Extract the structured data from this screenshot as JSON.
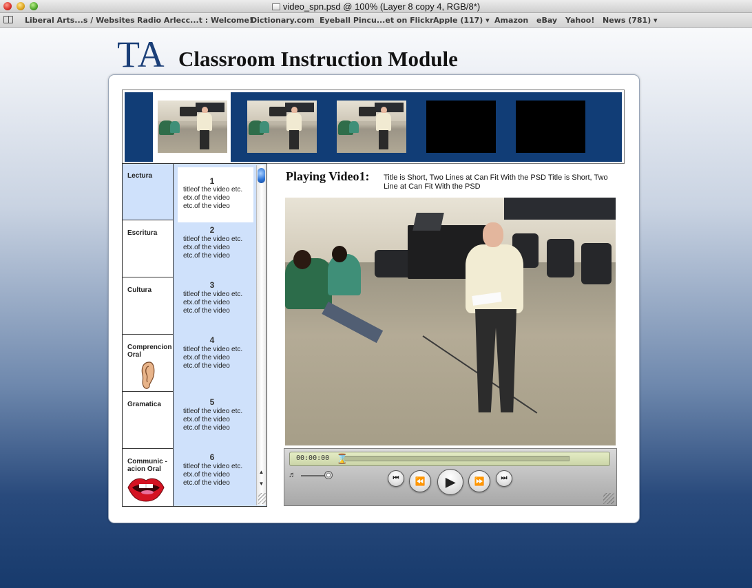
{
  "window": {
    "title": "video_spn.psd @ 100% (Layer 8 copy 4, RGB/8*)"
  },
  "bookmarks": [
    "Liberal Arts...s / Websites",
    "Radio Arlecc...t : Welcome!",
    "Dictionary.com",
    "Eyeball Pincu...et on Flickr",
    "Apple (117) ▾",
    "Amazon",
    "eBay",
    "Yahoo!",
    "News (781) ▾"
  ],
  "header": {
    "logo": "TA",
    "title": "Classroom Instruction Module"
  },
  "categories": [
    {
      "label": "Lectura",
      "active": true
    },
    {
      "label": "Escritura"
    },
    {
      "label": "Cultura"
    },
    {
      "label": "Comprencion Oral",
      "icon": "ear-icon"
    },
    {
      "label": "Gramatica"
    },
    {
      "label": "Communic -acion Oral",
      "icon": "mouth-icon"
    }
  ],
  "video_list": [
    {
      "num": "1",
      "lines": [
        "titleof the video etc.",
        "etx.of the video",
        "etc.of the video"
      ]
    },
    {
      "num": "2",
      "lines": [
        "titleof the video etc.",
        "etx.of the video",
        "etc.of the video"
      ]
    },
    {
      "num": "3",
      "lines": [
        "titleof the video etc.",
        "etx.of the video",
        "etc.of the video"
      ]
    },
    {
      "num": "4",
      "lines": [
        "titleof the video etc.",
        "etx.of the video",
        "etc.of the video"
      ]
    },
    {
      "num": "5",
      "lines": [
        "titleof the video etc.",
        "etx.of the video",
        "etc.of the video"
      ]
    },
    {
      "num": "6",
      "lines": [
        "titleof the video etc.",
        "etx.of the video",
        "etc.of the video"
      ]
    }
  ],
  "player": {
    "playing_label": "Playing Video1:",
    "playing_title": "Title is Short, Two Lines at Can Fit With the PSD Title is Short, Two Line at Can Fit With the PSD",
    "timecode": "00:00:00",
    "progress": 0.0
  },
  "colors": {
    "strip_blue": "#113d76",
    "selected_blue": "#cfe1fb",
    "brand_blue": "#1b3f78"
  }
}
